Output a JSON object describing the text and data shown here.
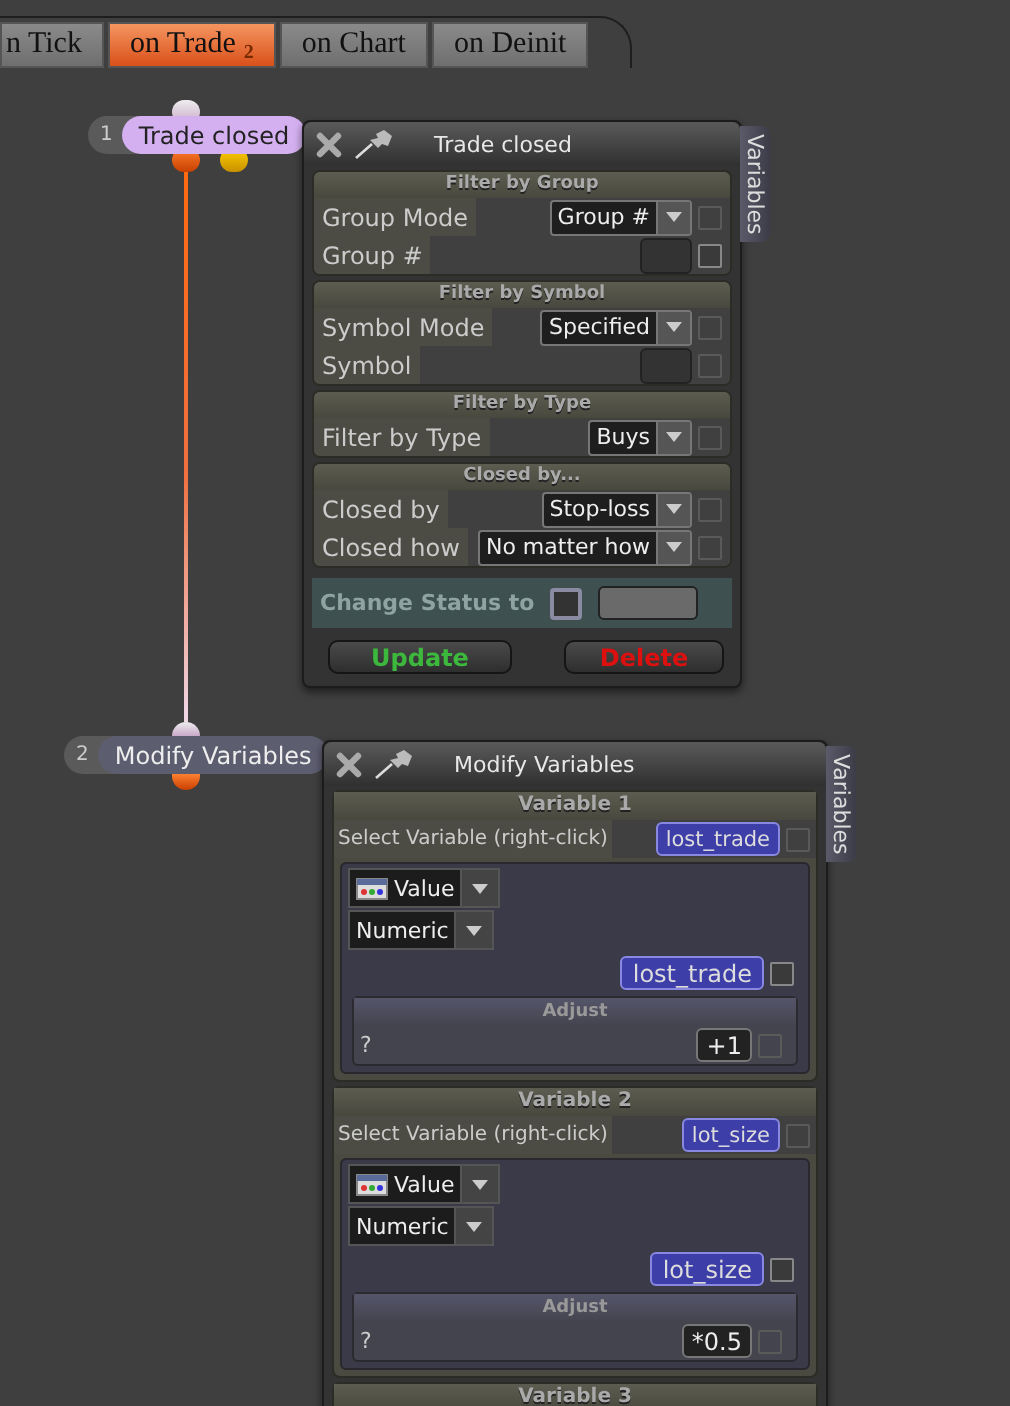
{
  "tabs": [
    {
      "label": "n Tick",
      "selected": false
    },
    {
      "label": "on Trade",
      "badge": "2",
      "selected": true
    },
    {
      "label": "on Chart",
      "selected": false
    },
    {
      "label": "on Deinit",
      "selected": false
    }
  ],
  "nodes": [
    {
      "number": "1",
      "label": "Trade closed",
      "selected": true
    },
    {
      "number": "2",
      "label": "Modify Variables",
      "selected": false
    }
  ],
  "trade_panel": {
    "title": "Trade closed",
    "side_tab": "Variables",
    "sections": [
      {
        "heading": "Filter by Group",
        "rows": [
          {
            "label": "Group Mode",
            "kind": "dropdown",
            "value": "Group #",
            "checked": false
          },
          {
            "label": "Group #",
            "kind": "field",
            "checked": false
          }
        ]
      },
      {
        "heading": "Filter by Symbol",
        "rows": [
          {
            "label": "Symbol Mode",
            "kind": "dropdown",
            "value": "Specified",
            "checked": false
          },
          {
            "label": "Symbol",
            "kind": "field",
            "checked": false
          }
        ]
      },
      {
        "heading": "Filter by Type",
        "rows": [
          {
            "label": "Filter by Type",
            "kind": "dropdown",
            "value": "Buys",
            "checked": false
          }
        ]
      },
      {
        "heading": "Closed by...",
        "rows": [
          {
            "label": "Closed by",
            "kind": "dropdown",
            "value": "Stop-loss",
            "checked": false
          },
          {
            "label": "Closed how",
            "kind": "dropdown",
            "value": "No matter how",
            "checked": false
          }
        ]
      }
    ],
    "status": {
      "label": "Change Status to",
      "checked": false
    },
    "buttons": [
      {
        "label": "Update",
        "kind": "update"
      },
      {
        "label": "Delete",
        "kind": "delete"
      }
    ]
  },
  "variables_panel": {
    "title": "Modify Variables",
    "side_tab": "Variables",
    "variables": [
      {
        "heading": "Variable 1",
        "select_label": "Select Variable (right-click)",
        "variable": "lost_trade",
        "select_checked": false,
        "source": "Value",
        "type": "Numeric",
        "target": "lost_trade",
        "target_checked": false,
        "adjust_heading": "Adjust",
        "adjust_label": "?",
        "adjust_value": "+1",
        "adjust_checked": false
      },
      {
        "heading": "Variable 2",
        "select_label": "Select Variable (right-click)",
        "variable": "lot_size",
        "select_checked": false,
        "source": "Value",
        "type": "Numeric",
        "target": "lot_size",
        "target_checked": false,
        "adjust_heading": "Adjust",
        "adjust_label": "?",
        "adjust_value": "*0.5",
        "adjust_checked": false
      },
      {
        "heading": "Variable 3"
      }
    ]
  }
}
